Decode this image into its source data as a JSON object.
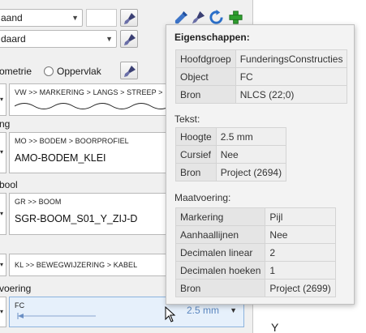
{
  "panel": {
    "row1_select": "aand",
    "row2_select": "daard",
    "radio_geometrie": "ometrie",
    "radio_oppervlak": "Oppervlak",
    "line_path": "VW >> MARKERING > LANGS > STREEP >",
    "section_ng": "ng",
    "boorprofiel_path": "MO >> BODEM > BOORPROFIEL",
    "boorprofiel_value": "AMO-BODEM_KLEI",
    "section_bool": "bool",
    "boom_path": "GR >> BOOM",
    "boom_value": "SGR-BOOM_S01_Y_ZIJ-D",
    "kabel_path": "KL >> BEWEGWIJZERING > KABEL",
    "section_voering": "voering",
    "dim_path": "FC",
    "dim_value": "2.5 mm"
  },
  "toolbar": {
    "icons": [
      "pipette-icon",
      "brush-icon",
      "refresh-icon",
      "add-icon"
    ]
  },
  "popup": {
    "title": "Eigenschappen:",
    "general": [
      {
        "key": "Hoofdgroep",
        "value": "FunderingsConstructies"
      },
      {
        "key": "Object",
        "value": "FC"
      },
      {
        "key": "Bron",
        "value": "NLCS (22;0)"
      }
    ],
    "tekst_label": "Tekst:",
    "tekst": [
      {
        "key": "Hoogte",
        "value": "2.5 mm"
      },
      {
        "key": "Cursief",
        "value": "Nee"
      },
      {
        "key": "Bron",
        "value": "Project (2694)"
      }
    ],
    "maat_label": "Maatvoering:",
    "maat": [
      {
        "key": "Markering",
        "value": "Pijl"
      },
      {
        "key": "Aanhaallijnen",
        "value": "Nee"
      },
      {
        "key": "Decimalen linear",
        "value": "2"
      },
      {
        "key": "Decimalen hoeken",
        "value": "1"
      },
      {
        "key": "Bron",
        "value": "Project (2699)"
      }
    ]
  },
  "canvas_text": "Y",
  "colors": {
    "accent": "#5b87c0",
    "highlight": "#e6f0fb"
  }
}
